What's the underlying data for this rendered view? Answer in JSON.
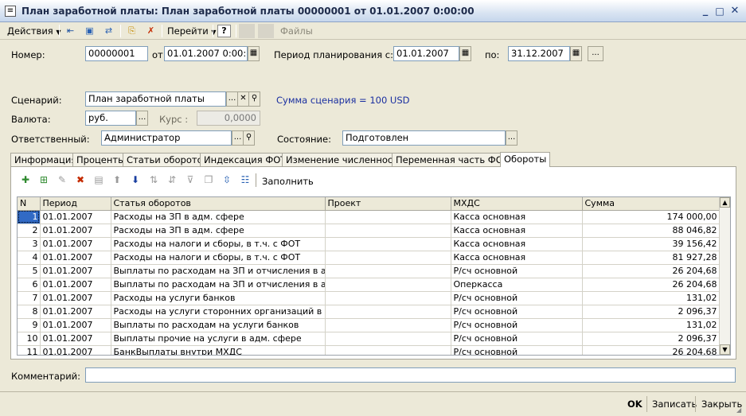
{
  "window": {
    "title": "План заработной платы: План заработной платы 00000001 от 01.01.2007 0:00:00",
    "minimize": "_",
    "maximize": "□",
    "close": "✕"
  },
  "toolbar": {
    "actions_label": "Действия",
    "goto_label": "Перейти",
    "files_label": "Файлы",
    "help_label": "?"
  },
  "form": {
    "number_label": "Номер:",
    "number_value": "00000001",
    "from_label": "от:",
    "from_value": "01.01.2007  0:00:00",
    "period_label": "Период планирования с:",
    "period_from": "01.01.2007",
    "period_to_label": "по:",
    "period_to": "31.12.2007",
    "scenario_label": "Сценарий:",
    "scenario_value": "План заработной платы",
    "scenario_sum": "Сумма сценария = 100 USD",
    "currency_label": "Валюта:",
    "currency_value": "руб.",
    "rate_label": "Курс :",
    "rate_value": "0,0000",
    "responsible_label": "Ответственный:",
    "responsible_value": "Администратор",
    "state_label": "Состояние:",
    "state_value": "Подготовлен",
    "comment_label": "Комментарий:",
    "comment_value": ""
  },
  "tabs": [
    {
      "label": "Информация"
    },
    {
      "label": "Проценты"
    },
    {
      "label": "Статьи оборотов"
    },
    {
      "label": "Индексация ФОТ"
    },
    {
      "label": "Изменение численности"
    },
    {
      "label": "Переменная часть ФОТ"
    },
    {
      "label": "Обороты"
    }
  ],
  "panel": {
    "fill_label": "Заполнить"
  },
  "grid": {
    "columns": [
      "N",
      "Период",
      "Статья оборотов",
      "Проект",
      "МХДС",
      "Сумма"
    ],
    "rows": [
      [
        "1",
        "01.01.2007",
        "Расходы на ЗП в адм. сфере",
        "",
        "Касса основная",
        "174 000,00"
      ],
      [
        "2",
        "01.01.2007",
        "Расходы на ЗП в адм. сфере",
        "",
        "Касса основная",
        "88 046,82"
      ],
      [
        "3",
        "01.01.2007",
        "Расходы на налоги и сборы, в т.ч. с  ФОТ",
        "",
        "Касса основная",
        "39 156,42"
      ],
      [
        "4",
        "01.01.2007",
        "Расходы на налоги и сборы, в т.ч. с  ФОТ",
        "",
        "Касса основная",
        "81 927,28"
      ],
      [
        "5",
        "01.01.2007",
        "Выплаты по расходам на ЗП и отчисления в адм. ...",
        "",
        "Р/сч основной",
        "26 204,68"
      ],
      [
        "6",
        "01.01.2007",
        "Выплаты по расходам на ЗП и отчисления в адм. ...",
        "",
        "Оперкасса",
        "26 204,68"
      ],
      [
        "7",
        "01.01.2007",
        "Расходы на услуги банков",
        "",
        "Р/сч основной",
        "131,02"
      ],
      [
        "8",
        "01.01.2007",
        "Расходы на услуги сторонних организаций  в адм. ...",
        "",
        "Р/сч основной",
        "2 096,37"
      ],
      [
        "9",
        "01.01.2007",
        "Выплаты по расходам на услуги банков",
        "",
        "Р/сч основной",
        "131,02"
      ],
      [
        "10",
        "01.01.2007",
        "Выплаты прочие на услуги  в адм. сфере",
        "",
        "Р/сч основной",
        "2 096,37"
      ],
      [
        "11",
        "01.01.2007",
        "БанкВыплаты внутри МХДС",
        "",
        "Р/сч основной",
        "26 204,68"
      ]
    ]
  },
  "statusbar": {
    "ok_label": "OK",
    "save_label": "Записать",
    "close_label": "Закрыть"
  }
}
